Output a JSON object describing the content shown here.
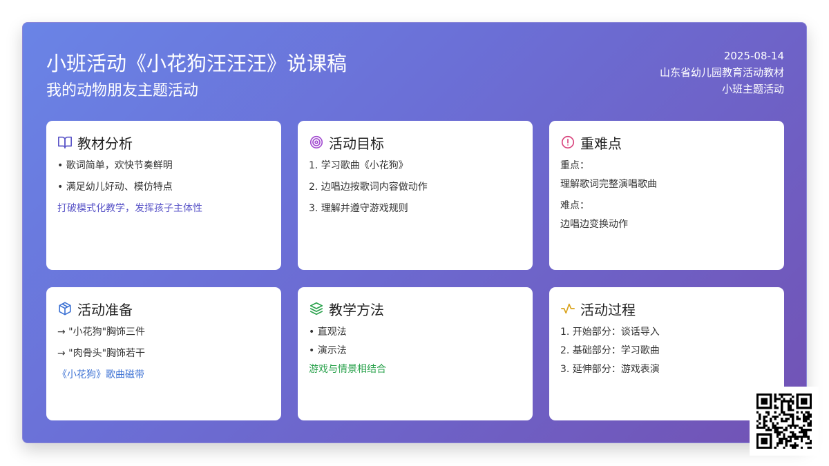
{
  "header": {
    "title": "小班活动《小花狗汪汪汪》说课稿",
    "subtitle": "我的动物朋友主题活动",
    "date": "2025-08-14",
    "source": "山东省幼儿园教育活动教材",
    "category": "小班主题活动"
  },
  "cards": {
    "material": {
      "icon": "book-open-icon",
      "title": "教材分析",
      "items": [
        "• 歌词简单，欢快节奏鲜明",
        "• 满足幼儿好动、模仿特点"
      ],
      "note": "打破模式化教学，发挥孩子主体性",
      "color": "#5b56c8"
    },
    "goals": {
      "icon": "target-icon",
      "title": "活动目标",
      "items": [
        "1. 学习歌曲《小花狗》",
        "2. 边唱边按歌词内容做动作",
        "3. 理解并遵守游戏规则"
      ],
      "color": "#a24bd0"
    },
    "keypoints": {
      "icon": "alert-circle-icon",
      "title": "重难点",
      "key_label": "重点：",
      "key_text": "理解歌词完整演唱歌曲",
      "difficulty_label": "难点：",
      "difficulty_text": "边唱边变换动作",
      "color": "#d8437c"
    },
    "preparation": {
      "icon": "box-icon",
      "title": "活动准备",
      "items": [
        "→ \"小花狗\"胸饰三件",
        "→ \"肉骨头\"胸饰若干"
      ],
      "note": "《小花狗》歌曲磁带",
      "color": "#3d72d4"
    },
    "methods": {
      "icon": "layers-icon",
      "title": "教学方法",
      "items": [
        "• 直观法",
        "• 演示法"
      ],
      "note": "游戏与情景相结合",
      "color": "#2aa24c"
    },
    "process": {
      "icon": "activity-icon",
      "title": "活动过程",
      "items": [
        "1. 开始部分：谈话导入",
        "2. 基础部分：学习歌曲",
        "3. 延伸部分：游戏表演"
      ],
      "color": "#d9a21a"
    }
  },
  "qr_code": {
    "icon": "qr-code-icon"
  }
}
